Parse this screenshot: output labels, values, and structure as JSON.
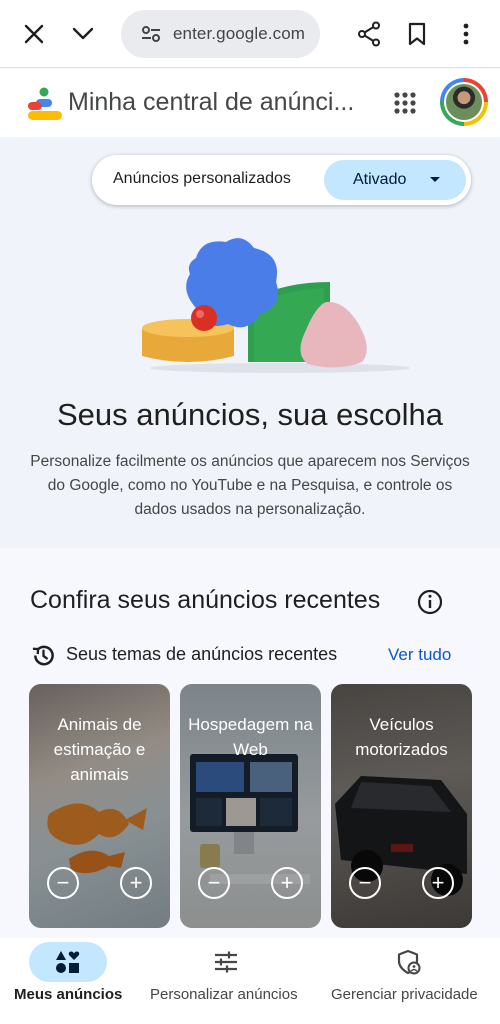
{
  "browser": {
    "url": "enter.google.com",
    "icons": [
      "close-icon",
      "chevron-down-icon",
      "tune-icon",
      "share-icon",
      "bookmark-icon",
      "more-vert-icon"
    ]
  },
  "app": {
    "title": "Minha central de anúnci..."
  },
  "personalization": {
    "label": "Anúncios personalizados",
    "value": "Ativado"
  },
  "hero": {
    "title": "Seus anúncios, sua escolha",
    "description": "Personalize facilmente os anúncios que aparecem nos Serviços do Google, como no YouTube e na Pesquisa, e controle os dados usados na personalização."
  },
  "recent": {
    "heading": "Confira seus anúncios recentes",
    "subheading": "Seus temas de anúncios recentes",
    "see_all": "Ver tudo",
    "cards": [
      {
        "title": "Animais de estimação e animais"
      },
      {
        "title": "Hospedagem na Web"
      },
      {
        "title": "Veículos motorizados"
      }
    ]
  },
  "bottom_nav": {
    "items": [
      {
        "label": "Meus anúncios",
        "active": true
      },
      {
        "label": "Personalizar anúncios",
        "active": false
      },
      {
        "label": "Gerenciar privacidade",
        "active": false
      }
    ]
  },
  "colors": {
    "accent": "#0b57d0",
    "selected_bg": "#c2e7ff"
  }
}
